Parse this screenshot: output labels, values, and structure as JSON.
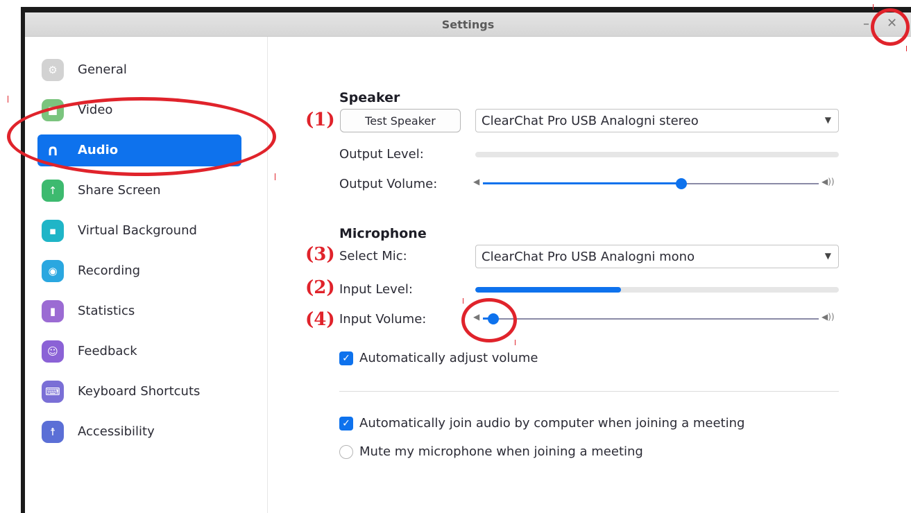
{
  "window": {
    "title": "Settings",
    "minimize_glyph": "–",
    "close_glyph": "✕"
  },
  "sidebar": {
    "items": [
      {
        "label": "General",
        "icon": "gear-icon",
        "color": "#c9c9c9",
        "glyph": "⚙"
      },
      {
        "label": "Video",
        "icon": "camera-icon",
        "color": "#7bc47e",
        "glyph": "■"
      },
      {
        "label": "Audio",
        "icon": "headphones-icon",
        "color": "#0e72ed",
        "glyph": "∩",
        "active": true
      },
      {
        "label": "Share Screen",
        "icon": "share-screen-icon",
        "color": "#3dba6f",
        "glyph": "↑"
      },
      {
        "label": "Virtual Background",
        "icon": "person-icon",
        "color": "#1fb5c7",
        "glyph": "▪"
      },
      {
        "label": "Recording",
        "icon": "record-icon",
        "color": "#2aa7e0",
        "glyph": "◉"
      },
      {
        "label": "Statistics",
        "icon": "bar-chart-icon",
        "color": "#9b6bd3",
        "glyph": "▮"
      },
      {
        "label": "Feedback",
        "icon": "smiley-icon",
        "color": "#8b62d6",
        "glyph": "☺"
      },
      {
        "label": "Keyboard Shortcuts",
        "icon": "keyboard-icon",
        "color": "#7a6fd6",
        "glyph": "⌨"
      },
      {
        "label": "Accessibility",
        "icon": "accessibility-icon",
        "color": "#5b6fd6",
        "glyph": "☨"
      }
    ]
  },
  "speaker": {
    "title": "Speaker",
    "test_button": "Test Speaker",
    "device": "ClearChat Pro USB Analogni stereo",
    "output_level_label": "Output Level:",
    "output_level": 0,
    "output_volume_label": "Output Volume:",
    "output_volume": 0.59
  },
  "microphone": {
    "title": "Microphone",
    "select_label": "Select Mic:",
    "device": "ClearChat Pro USB Analogni mono",
    "input_level_label": "Input Level:",
    "input_level": 0.4,
    "input_volume_label": "Input Volume:",
    "input_volume": 0.03,
    "auto_adjust_label": "Automatically adjust volume",
    "auto_adjust": true
  },
  "options": {
    "auto_join_label": "Automatically join audio by computer when joining a meeting",
    "auto_join": true,
    "mute_label": "Mute my microphone when joining a meeting",
    "mute": false
  },
  "annotations": {
    "n1": "(1)",
    "n2": "(2)",
    "n3": "(3)",
    "n4": "(4)"
  },
  "colors": {
    "accent": "#0e72ed",
    "annotation": "#e0232b"
  }
}
